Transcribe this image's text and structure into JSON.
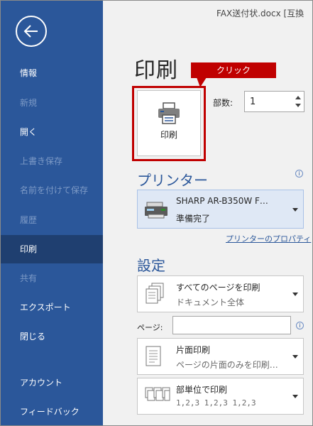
{
  "window": {
    "title": "FAX送付状.docx [互換"
  },
  "sidebar": {
    "items": [
      {
        "label": "情報"
      },
      {
        "label": "新規"
      },
      {
        "label": "開く"
      },
      {
        "label": "上書き保存"
      },
      {
        "label": "名前を付けて保存"
      },
      {
        "label": "履歴"
      },
      {
        "label": "印刷"
      },
      {
        "label": "共有"
      },
      {
        "label": "エクスポート"
      },
      {
        "label": "閉じる"
      },
      {
        "label": "アカウント"
      },
      {
        "label": "フィードバック"
      }
    ],
    "selected": "印刷"
  },
  "print": {
    "title": "印刷",
    "button_label": "印刷",
    "callout": "クリック",
    "copies_label": "部数:",
    "copies_value": "1"
  },
  "printer": {
    "heading": "プリンター",
    "info": "i",
    "name": "SHARP AR-B350W F…",
    "status": "準備完了",
    "properties_link": "プリンターのプロパティ"
  },
  "settings": {
    "heading": "設定",
    "range": {
      "main": "すべてのページを印刷",
      "sub": "ドキュメント全体"
    },
    "pages_label": "ページ:",
    "pages_value": "",
    "info": "i",
    "sides": {
      "main": "片面印刷",
      "sub": "ページの片面のみを印刷…"
    },
    "collate": {
      "main": "部単位で印刷",
      "sub": "1,2,3    1,2,3    1,2,3"
    }
  },
  "colors": {
    "sidebar": "#2b579a",
    "sidebar_selected": "#1f3f70",
    "highlight": "#c00000",
    "accent": "#2b579a"
  }
}
